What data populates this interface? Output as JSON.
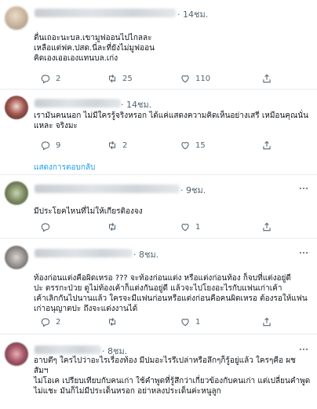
{
  "tweets": [
    {
      "time": "· 14ชม.",
      "text": "ตื่นเถอะนะบล.เขามูฟออนไปไกลละ\nเหลือแต่ฟค.ปสด.นี่ละที่ยังไม่มูฟออน\nคิดเองเออเองแทนบล.เก่ง",
      "replies": "2",
      "retweets": "25",
      "likes": "110"
    },
    {
      "time": "· 14ชม.",
      "text": "เรามันคนนอก ไม่มีใครรู้จริงหรอก  ได้แค่แสดงความคิดเห็นอย่างเสรี เหมือนคุณนั่น\nแหละ จริงมะ",
      "replies": "9",
      "retweets": "2",
      "likes": "15",
      "show_replies": "แสดงการตอบกลับ"
    },
    {
      "time": "· 9ชม.",
      "text": "มีประโยคไหนที่ไม่ให้เกียรติองจง",
      "replies": "",
      "retweets": "",
      "likes": "1"
    },
    {
      "time": "· 8ชม.",
      "text": "ท้องก่อนแต่งคือผิดเหรอ ???    จะท้องก่อนแต่ง หรือแต่งก่อนท้อง  ก็จบที่แต่งอยู่ดี\nปะ  ตรรกะป่วย      ดูไม่ท้องเค้าก็แต่งกันอยู่ดี  แล้วจะไปโยงอะไรกับแฟนเก่าเค้า\nเค้าเลิกกันไปนานแล้ว  ใครจะมีแฟนก่อนหรือแต่งก่อนคือคนผิดเหรอ  ต้องรอให้แฟน\nเก่าอนุญาตปะ ถึงจะแต่งงานได้",
      "replies": "2",
      "retweets": "",
      "likes": "1"
    },
    {
      "time": "· 8ชม.",
      "text": "อาบตึๆ ใครไปว่าอะไรเรื่องท้อง มีปมอะไรรึเปล่าหรือลึกๆก็รู้อยู่แล้ว ใครๆคือ ผช สัมฯ\nไม่โอเค เปรียบเทียบกับคนเก่า ใช้คำพูดที่รู้สึกว่าเกี่ยวข้องกับคนเก่า แต่เปลี่ยนคำพูด\nไม่แชะ มันก็ไม่มีประเด็นหรอก อย่าหลงประเด็นค่ะหนูลูก",
      "replies": "",
      "retweets": "",
      "likes": ""
    }
  ],
  "icons": {
    "reply": "reply-icon",
    "retweet": "retweet-icon",
    "like": "heart-icon",
    "share": "share-icon",
    "more": "more-icon"
  },
  "colors": {
    "text": "#0f1419",
    "secondary": "#536471",
    "link": "#1d9bf0",
    "divider": "#e6ecf0"
  }
}
